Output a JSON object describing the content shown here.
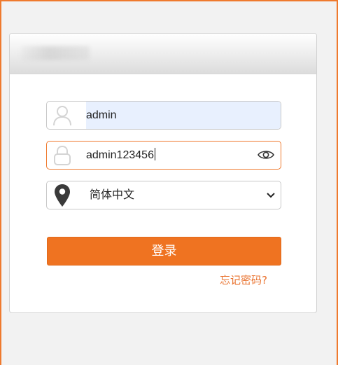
{
  "login": {
    "username": "admin",
    "password": "admin123456",
    "language": "简体中文",
    "login_label": "登录",
    "forgot_label": "忘记密码?"
  },
  "colors": {
    "accent": "#ef7321",
    "focus_border": "#ef7a2e",
    "autofill_bg": "#e8f0fe"
  },
  "icons": {
    "user": "user-icon",
    "lock": "lock-icon",
    "location": "location-pin-icon",
    "eye": "eye-icon",
    "chevron": "chevron-down-icon"
  }
}
